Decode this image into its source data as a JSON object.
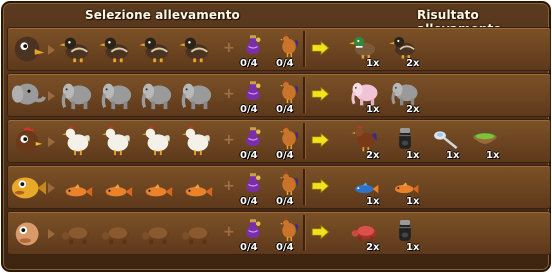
{
  "headers": {
    "selection": "Selezione allevamento",
    "result": "Risultato allevamento"
  },
  "rows": [
    {
      "animal": "duck",
      "parent_icon": "duck-portrait-icon",
      "input_counts": [
        "0/4",
        "0/4"
      ],
      "results": [
        {
          "icon": "green-head-duck-icon",
          "count": "1x"
        },
        {
          "icon": "duck-icon",
          "count": "2x"
        }
      ]
    },
    {
      "animal": "elephant",
      "parent_icon": "elephant-portrait-icon",
      "input_counts": [
        "0/4",
        "0/4"
      ],
      "results": [
        {
          "icon": "pink-elephant-icon",
          "count": "1x"
        },
        {
          "icon": "elephant-icon",
          "count": "2x"
        }
      ]
    },
    {
      "animal": "chicken",
      "parent_icon": "chicken-portrait-icon",
      "input_counts": [
        "0/4",
        "0/4"
      ],
      "results": [
        {
          "icon": "brown-chicken-icon",
          "count": "2x"
        },
        {
          "icon": "potion-jar-icon",
          "count": "1x"
        },
        {
          "icon": "spoon-icon",
          "count": "1x"
        },
        {
          "icon": "green-bowl-icon",
          "count": "1x"
        }
      ]
    },
    {
      "animal": "fish",
      "parent_icon": "fish-portrait-icon",
      "input_counts": [
        "0/4",
        "0/4"
      ],
      "results": [
        {
          "icon": "blue-fish-icon",
          "count": "1x"
        },
        {
          "icon": "orange-fish-icon",
          "count": "1x"
        }
      ]
    },
    {
      "animal": "turtle",
      "parent_icon": "turtle-portrait-icon",
      "input_counts": [
        "0/4",
        "0/4"
      ],
      "results": [
        {
          "icon": "red-turtle-icon",
          "count": "2x"
        },
        {
          "icon": "potion-jar-icon",
          "count": "1x"
        }
      ]
    }
  ],
  "colors": {
    "panel": "#5b3a1e",
    "arrow": "#f3e21b",
    "potion": "#7a2ea8",
    "rooster": "#c9742a"
  }
}
